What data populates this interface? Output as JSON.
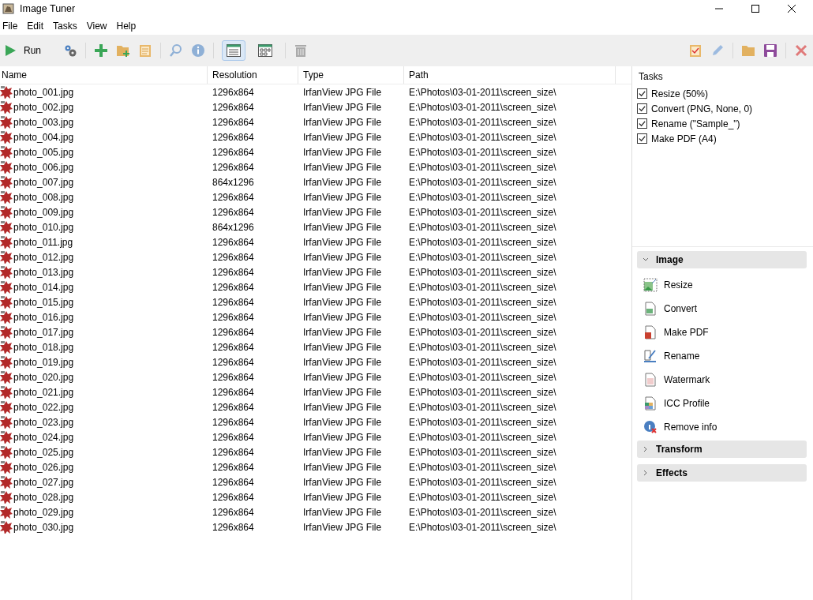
{
  "window": {
    "title": "Image Tuner"
  },
  "menu": [
    "File",
    "Edit",
    "Tasks",
    "View",
    "Help"
  ],
  "toolbar": {
    "run_label": "Run",
    "views": [
      {
        "selected": true
      },
      {
        "selected": false
      }
    ]
  },
  "table": {
    "columns": [
      "Name",
      "Resolution",
      "Type",
      "Path"
    ],
    "rows": [
      {
        "name": "photo_001.jpg",
        "resolution": "1296x864",
        "type": "IrfanView JPG File",
        "path": "E:\\Photos\\03-01-2011\\screen_size\\"
      },
      {
        "name": "photo_002.jpg",
        "resolution": "1296x864",
        "type": "IrfanView JPG File",
        "path": "E:\\Photos\\03-01-2011\\screen_size\\"
      },
      {
        "name": "photo_003.jpg",
        "resolution": "1296x864",
        "type": "IrfanView JPG File",
        "path": "E:\\Photos\\03-01-2011\\screen_size\\"
      },
      {
        "name": "photo_004.jpg",
        "resolution": "1296x864",
        "type": "IrfanView JPG File",
        "path": "E:\\Photos\\03-01-2011\\screen_size\\"
      },
      {
        "name": "photo_005.jpg",
        "resolution": "1296x864",
        "type": "IrfanView JPG File",
        "path": "E:\\Photos\\03-01-2011\\screen_size\\"
      },
      {
        "name": "photo_006.jpg",
        "resolution": "1296x864",
        "type": "IrfanView JPG File",
        "path": "E:\\Photos\\03-01-2011\\screen_size\\"
      },
      {
        "name": "photo_007.jpg",
        "resolution": "864x1296",
        "type": "IrfanView JPG File",
        "path": "E:\\Photos\\03-01-2011\\screen_size\\"
      },
      {
        "name": "photo_008.jpg",
        "resolution": "1296x864",
        "type": "IrfanView JPG File",
        "path": "E:\\Photos\\03-01-2011\\screen_size\\"
      },
      {
        "name": "photo_009.jpg",
        "resolution": "1296x864",
        "type": "IrfanView JPG File",
        "path": "E:\\Photos\\03-01-2011\\screen_size\\"
      },
      {
        "name": "photo_010.jpg",
        "resolution": "864x1296",
        "type": "IrfanView JPG File",
        "path": "E:\\Photos\\03-01-2011\\screen_size\\"
      },
      {
        "name": "photo_011.jpg",
        "resolution": "1296x864",
        "type": "IrfanView JPG File",
        "path": "E:\\Photos\\03-01-2011\\screen_size\\"
      },
      {
        "name": "photo_012.jpg",
        "resolution": "1296x864",
        "type": "IrfanView JPG File",
        "path": "E:\\Photos\\03-01-2011\\screen_size\\"
      },
      {
        "name": "photo_013.jpg",
        "resolution": "1296x864",
        "type": "IrfanView JPG File",
        "path": "E:\\Photos\\03-01-2011\\screen_size\\"
      },
      {
        "name": "photo_014.jpg",
        "resolution": "1296x864",
        "type": "IrfanView JPG File",
        "path": "E:\\Photos\\03-01-2011\\screen_size\\"
      },
      {
        "name": "photo_015.jpg",
        "resolution": "1296x864",
        "type": "IrfanView JPG File",
        "path": "E:\\Photos\\03-01-2011\\screen_size\\"
      },
      {
        "name": "photo_016.jpg",
        "resolution": "1296x864",
        "type": "IrfanView JPG File",
        "path": "E:\\Photos\\03-01-2011\\screen_size\\"
      },
      {
        "name": "photo_017.jpg",
        "resolution": "1296x864",
        "type": "IrfanView JPG File",
        "path": "E:\\Photos\\03-01-2011\\screen_size\\"
      },
      {
        "name": "photo_018.jpg",
        "resolution": "1296x864",
        "type": "IrfanView JPG File",
        "path": "E:\\Photos\\03-01-2011\\screen_size\\"
      },
      {
        "name": "photo_019.jpg",
        "resolution": "1296x864",
        "type": "IrfanView JPG File",
        "path": "E:\\Photos\\03-01-2011\\screen_size\\"
      },
      {
        "name": "photo_020.jpg",
        "resolution": "1296x864",
        "type": "IrfanView JPG File",
        "path": "E:\\Photos\\03-01-2011\\screen_size\\"
      },
      {
        "name": "photo_021.jpg",
        "resolution": "1296x864",
        "type": "IrfanView JPG File",
        "path": "E:\\Photos\\03-01-2011\\screen_size\\"
      },
      {
        "name": "photo_022.jpg",
        "resolution": "1296x864",
        "type": "IrfanView JPG File",
        "path": "E:\\Photos\\03-01-2011\\screen_size\\"
      },
      {
        "name": "photo_023.jpg",
        "resolution": "1296x864",
        "type": "IrfanView JPG File",
        "path": "E:\\Photos\\03-01-2011\\screen_size\\"
      },
      {
        "name": "photo_024.jpg",
        "resolution": "1296x864",
        "type": "IrfanView JPG File",
        "path": "E:\\Photos\\03-01-2011\\screen_size\\"
      },
      {
        "name": "photo_025.jpg",
        "resolution": "1296x864",
        "type": "IrfanView JPG File",
        "path": "E:\\Photos\\03-01-2011\\screen_size\\"
      },
      {
        "name": "photo_026.jpg",
        "resolution": "1296x864",
        "type": "IrfanView JPG File",
        "path": "E:\\Photos\\03-01-2011\\screen_size\\"
      },
      {
        "name": "photo_027.jpg",
        "resolution": "1296x864",
        "type": "IrfanView JPG File",
        "path": "E:\\Photos\\03-01-2011\\screen_size\\"
      },
      {
        "name": "photo_028.jpg",
        "resolution": "1296x864",
        "type": "IrfanView JPG File",
        "path": "E:\\Photos\\03-01-2011\\screen_size\\"
      },
      {
        "name": "photo_029.jpg",
        "resolution": "1296x864",
        "type": "IrfanView JPG File",
        "path": "E:\\Photos\\03-01-2011\\screen_size\\"
      },
      {
        "name": "photo_030.jpg",
        "resolution": "1296x864",
        "type": "IrfanView JPG File",
        "path": "E:\\Photos\\03-01-2011\\screen_size\\"
      }
    ]
  },
  "tasks": {
    "title": "Tasks",
    "items": [
      {
        "label": "Resize (50%)",
        "checked": true
      },
      {
        "label": "Convert (PNG, None, 0)",
        "checked": true
      },
      {
        "label": "Rename (\"Sample_\")",
        "checked": true
      },
      {
        "label": "Make PDF (A4)",
        "checked": true
      }
    ]
  },
  "sections": [
    {
      "title": "Image",
      "expanded": true,
      "items": [
        "Resize",
        "Convert",
        "Make PDF",
        "Rename",
        "Watermark",
        "ICC Profile",
        "Remove info"
      ]
    },
    {
      "title": "Transform",
      "expanded": false
    },
    {
      "title": "Effects",
      "expanded": false
    }
  ]
}
